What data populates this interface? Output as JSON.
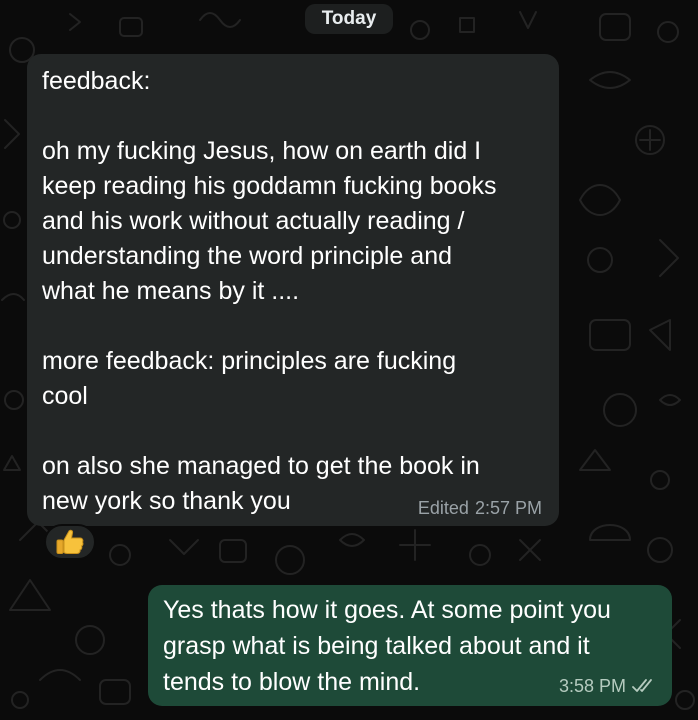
{
  "date_divider": "Today",
  "messages": [
    {
      "direction": "incoming",
      "lines": [
        "feedback:",
        "",
        "oh my fucking Jesus, how on earth did I",
        "keep reading his goddamn fucking books",
        "and his work without actually reading /",
        "understanding the word principle and",
        "what he means by it ....",
        "",
        "more feedback: principles are fucking",
        "cool",
        "",
        "on also she managed to get the book in",
        "new york so thank you"
      ],
      "edited_label": "Edited",
      "time": "2:57 PM",
      "reaction": "thumbs-up"
    },
    {
      "direction": "outgoing",
      "lines": [
        "Yes thats how it goes. At some point you",
        "grasp what is being talked about and it",
        "tends to blow the mind."
      ],
      "time": "3:58 PM",
      "status": "read-double-check"
    }
  ],
  "colors": {
    "background": "#0b0b0b",
    "incoming_bubble": "#232626",
    "outgoing_bubble": "#1e4a38",
    "timestamp_incoming": "#9aa2a7",
    "timestamp_outgoing": "#b5cbbf"
  }
}
